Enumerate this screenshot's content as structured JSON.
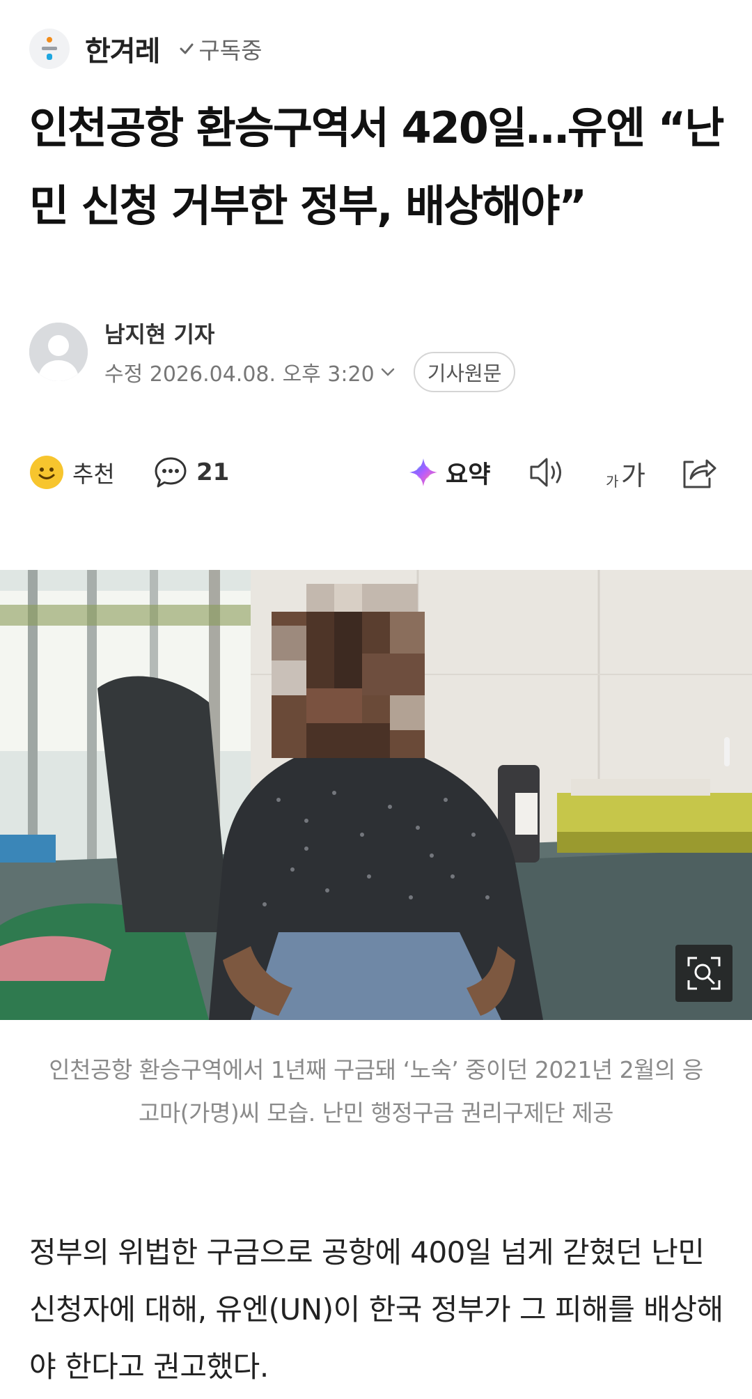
{
  "press": {
    "name": "한겨레",
    "subscribe_label": "구독중",
    "logo_icon": "hankyoreh-logo-icon"
  },
  "article": {
    "headline": "인천공항 환승구역서 420일…유엔 “난민 신청 거부한 정부, 배상해야”",
    "author": "남지현 기자",
    "modified": "수정 2026.04.08. 오후 3:20",
    "original_button": "기사원문",
    "caption": "인천공항 환승구역에서 1년째 구금돼 ‘노숙’ 중이던 2021년 2월의 응고마(가명)씨 모습. 난민 행정구금 권리구제단 제공",
    "body": "정부의 위법한 구금으로 공항에 400일 넘게 갇혔던 난민 신청자에 대해, 유엔(UN)이 한국 정부가 그 피해를 배상해야 한다고 권고했다."
  },
  "actions": {
    "recommend_label": "추천",
    "comment_count": "21",
    "summary_label": "요약",
    "font_size_label": "가가",
    "icons": [
      "smile-icon",
      "comment-icon",
      "ai-summary-icon",
      "speaker-icon",
      "font-size-icon",
      "share-icon",
      "zoom-icon"
    ]
  },
  "colors": {
    "text": "#111111",
    "muted": "#8a8a8a",
    "smile": "#f7c52e",
    "summary_gradient": [
      "#4c7dff",
      "#b35cff",
      "#ff6fae"
    ]
  }
}
